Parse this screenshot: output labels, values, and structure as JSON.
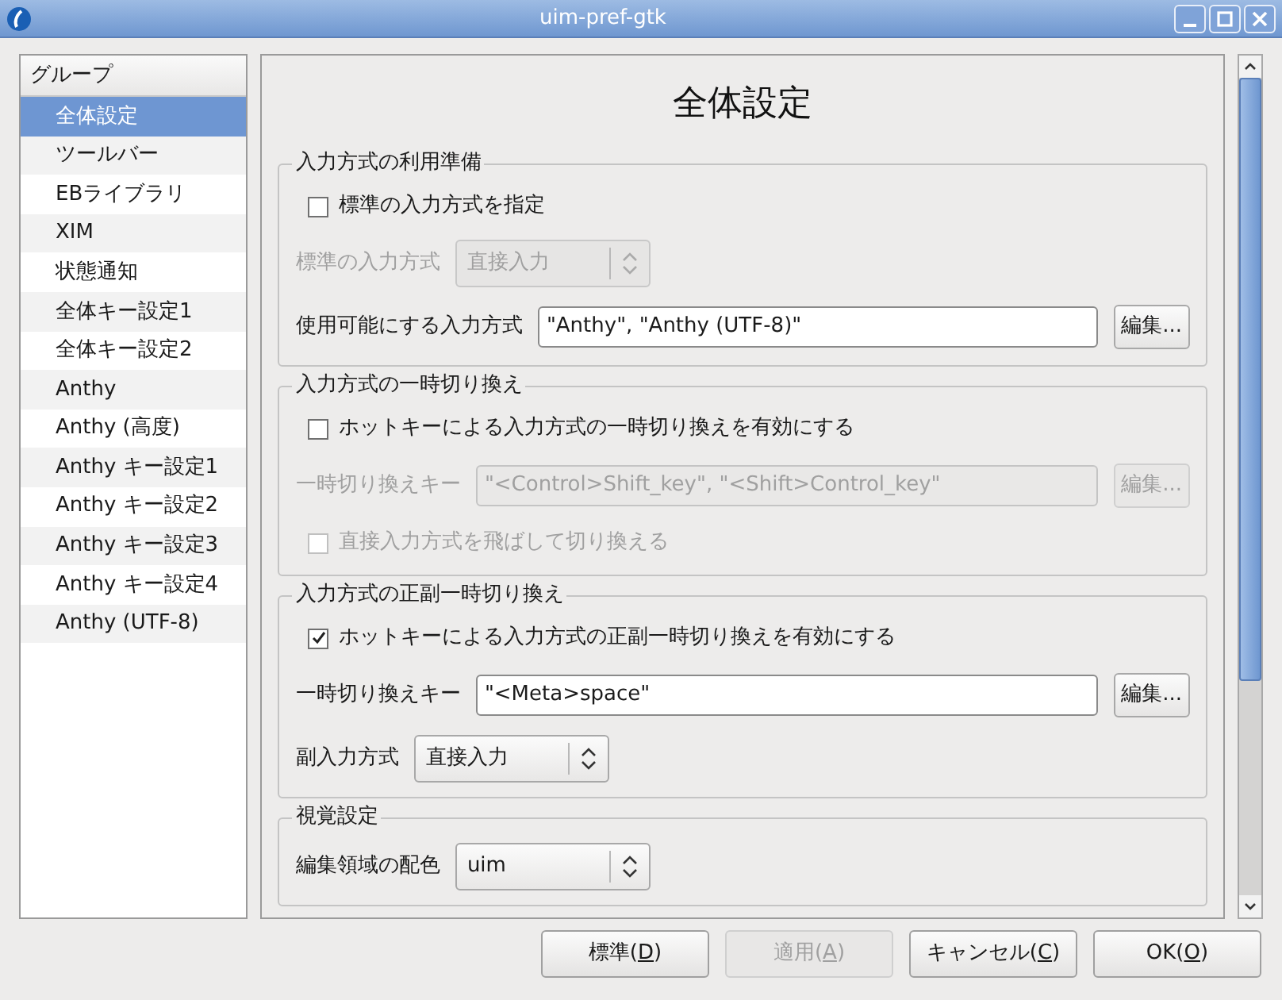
{
  "window": {
    "title": "uim-pref-gtk"
  },
  "sidebar": {
    "header": "グループ",
    "items": [
      {
        "label": "全体設定",
        "selected": true
      },
      {
        "label": "ツールバー",
        "selected": false
      },
      {
        "label": "EBライブラリ",
        "selected": false
      },
      {
        "label": "XIM",
        "selected": false
      },
      {
        "label": "状態通知",
        "selected": false
      },
      {
        "label": "全体キー設定1",
        "selected": false
      },
      {
        "label": "全体キー設定2",
        "selected": false
      },
      {
        "label": "Anthy",
        "selected": false
      },
      {
        "label": "Anthy (高度)",
        "selected": false
      },
      {
        "label": "Anthy キー設定1",
        "selected": false
      },
      {
        "label": "Anthy キー設定2",
        "selected": false
      },
      {
        "label": "Anthy キー設定3",
        "selected": false
      },
      {
        "label": "Anthy キー設定4",
        "selected": false
      },
      {
        "label": "Anthy (UTF-8)",
        "selected": false
      }
    ]
  },
  "page": {
    "title": "全体設定",
    "sections": [
      {
        "title": "入力方式の利用準備",
        "rows": [
          {
            "kind": "checkbox",
            "label": "標準の入力方式を指定",
            "checked": false,
            "disabled": false
          },
          {
            "kind": "combo",
            "label": "標準の入力方式",
            "value": "直接入力",
            "disabled": true
          },
          {
            "kind": "entry",
            "label": "使用可能にする入力方式",
            "value": "\"Anthy\", \"Anthy (UTF-8)\"",
            "button": "編集...",
            "disabled": false
          }
        ]
      },
      {
        "title": "入力方式の一時切り換え",
        "rows": [
          {
            "kind": "checkbox",
            "label": "ホットキーによる入力方式の一時切り換えを有効にする",
            "checked": false,
            "disabled": false
          },
          {
            "kind": "entry",
            "label": "一時切り換えキー",
            "value": "\"<Control>Shift_key\", \"<Shift>Control_key\"",
            "button": "編集...",
            "disabled": true
          },
          {
            "kind": "checkbox",
            "label": "直接入力方式を飛ばして切り換える",
            "checked": false,
            "disabled": true
          }
        ]
      },
      {
        "title": "入力方式の正副一時切り換え",
        "rows": [
          {
            "kind": "checkbox",
            "label": "ホットキーによる入力方式の正副一時切り換えを有効にする",
            "checked": true,
            "disabled": false
          },
          {
            "kind": "entry",
            "label": "一時切り換えキー",
            "value": "\"<Meta>space\"",
            "button": "編集...",
            "disabled": false
          },
          {
            "kind": "combo",
            "label": "副入力方式",
            "value": "直接入力",
            "disabled": false
          }
        ]
      },
      {
        "title": "視覚設定",
        "rows": [
          {
            "kind": "combo",
            "label": "編集領域の配色",
            "value": "uim",
            "disabled": false
          }
        ]
      }
    ]
  },
  "buttons": [
    {
      "before": "標準(",
      "mnemonic": "D",
      "after": ")",
      "disabled": false
    },
    {
      "before": "適用(",
      "mnemonic": "A",
      "after": ")",
      "disabled": true
    },
    {
      "before": "キャンセル(",
      "mnemonic": "C",
      "after": ")",
      "disabled": false
    },
    {
      "before": "OK(",
      "mnemonic": "O",
      "after": ")",
      "disabled": false
    }
  ]
}
